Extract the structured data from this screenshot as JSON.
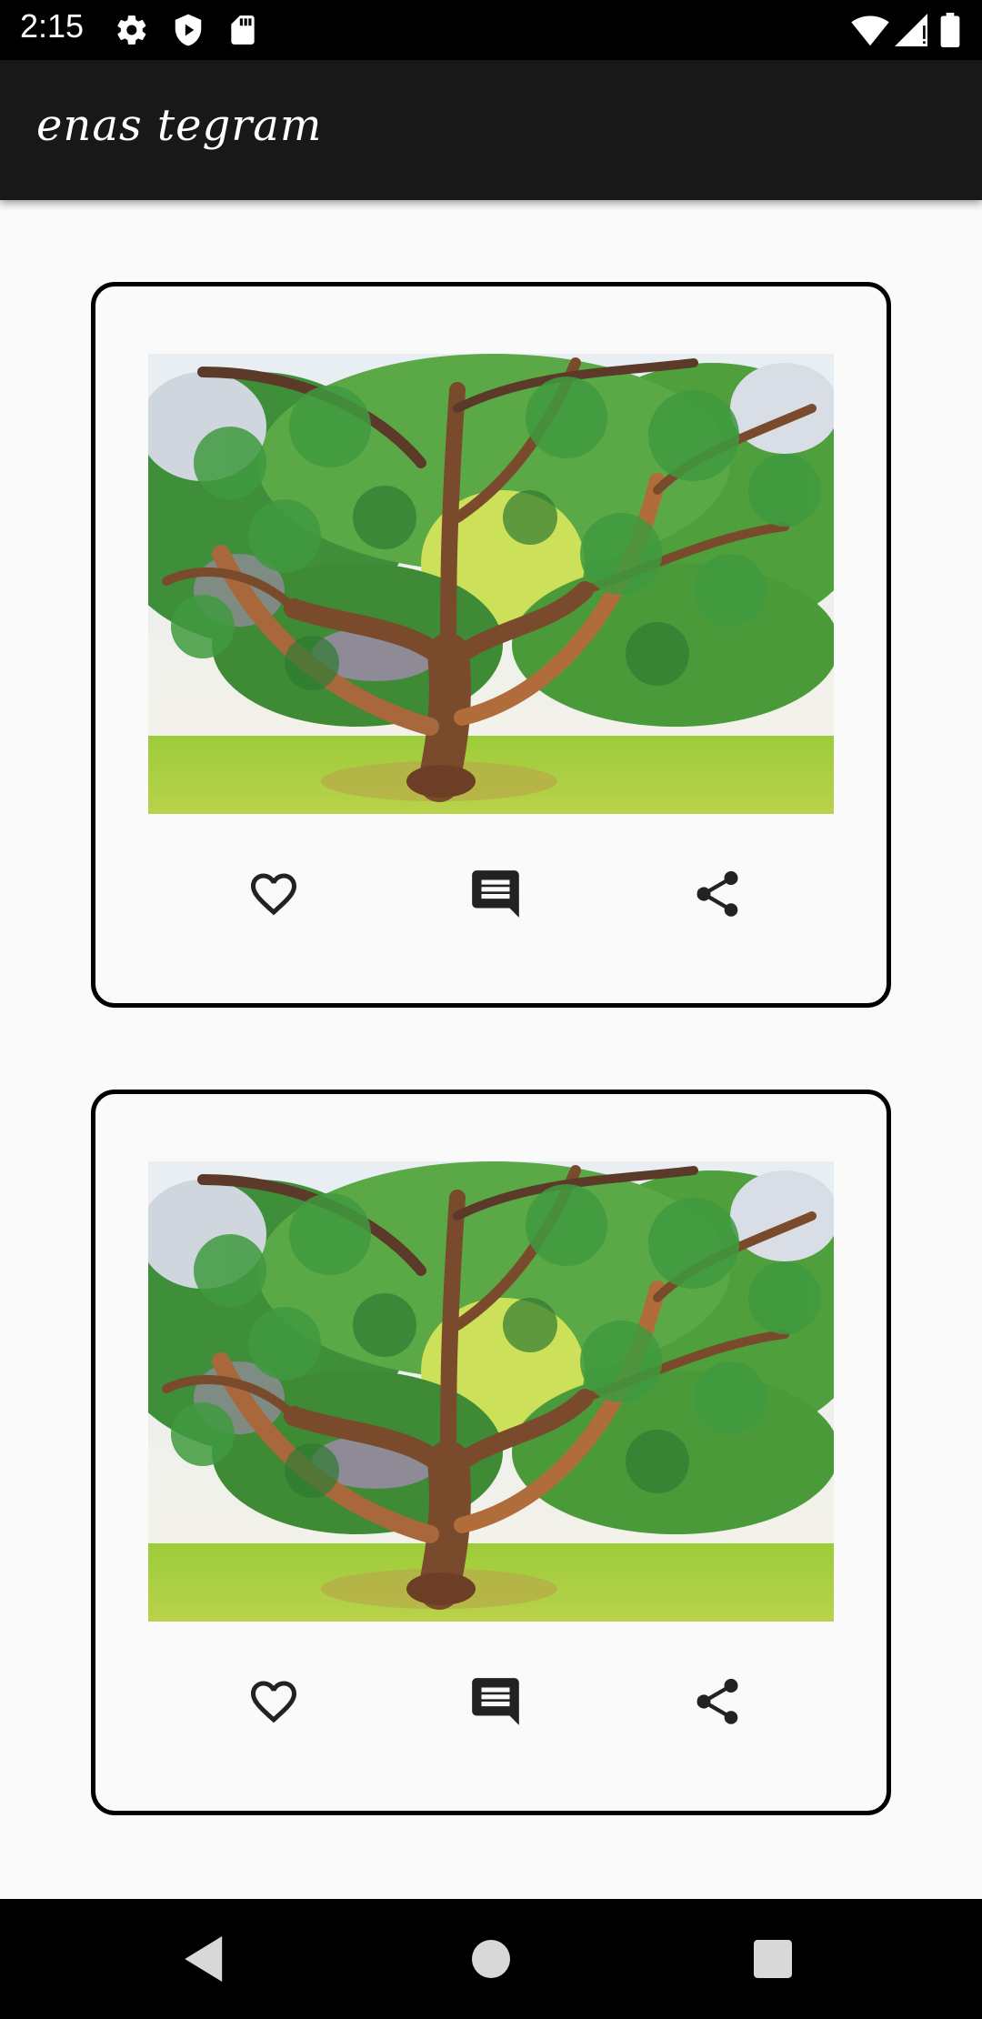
{
  "status": {
    "time": "2:15"
  },
  "app": {
    "title": "enas tegram"
  },
  "posts": [
    {
      "image_alt": "tree"
    },
    {
      "image_alt": "tree"
    }
  ],
  "icons": {
    "settings": "gear-icon",
    "shield": "shield-play-icon",
    "sd": "sd-card-icon",
    "wifi": "wifi-icon",
    "signal": "signal-icon",
    "battery": "battery-icon",
    "like": "heart-outline-icon",
    "comment": "comment-icon",
    "share": "share-icon",
    "back": "nav-back-icon",
    "home": "nav-home-icon",
    "recents": "nav-recents-icon"
  },
  "colors": {
    "app_bar": "#181818",
    "background": "#fafafa",
    "card_border": "#000000"
  }
}
